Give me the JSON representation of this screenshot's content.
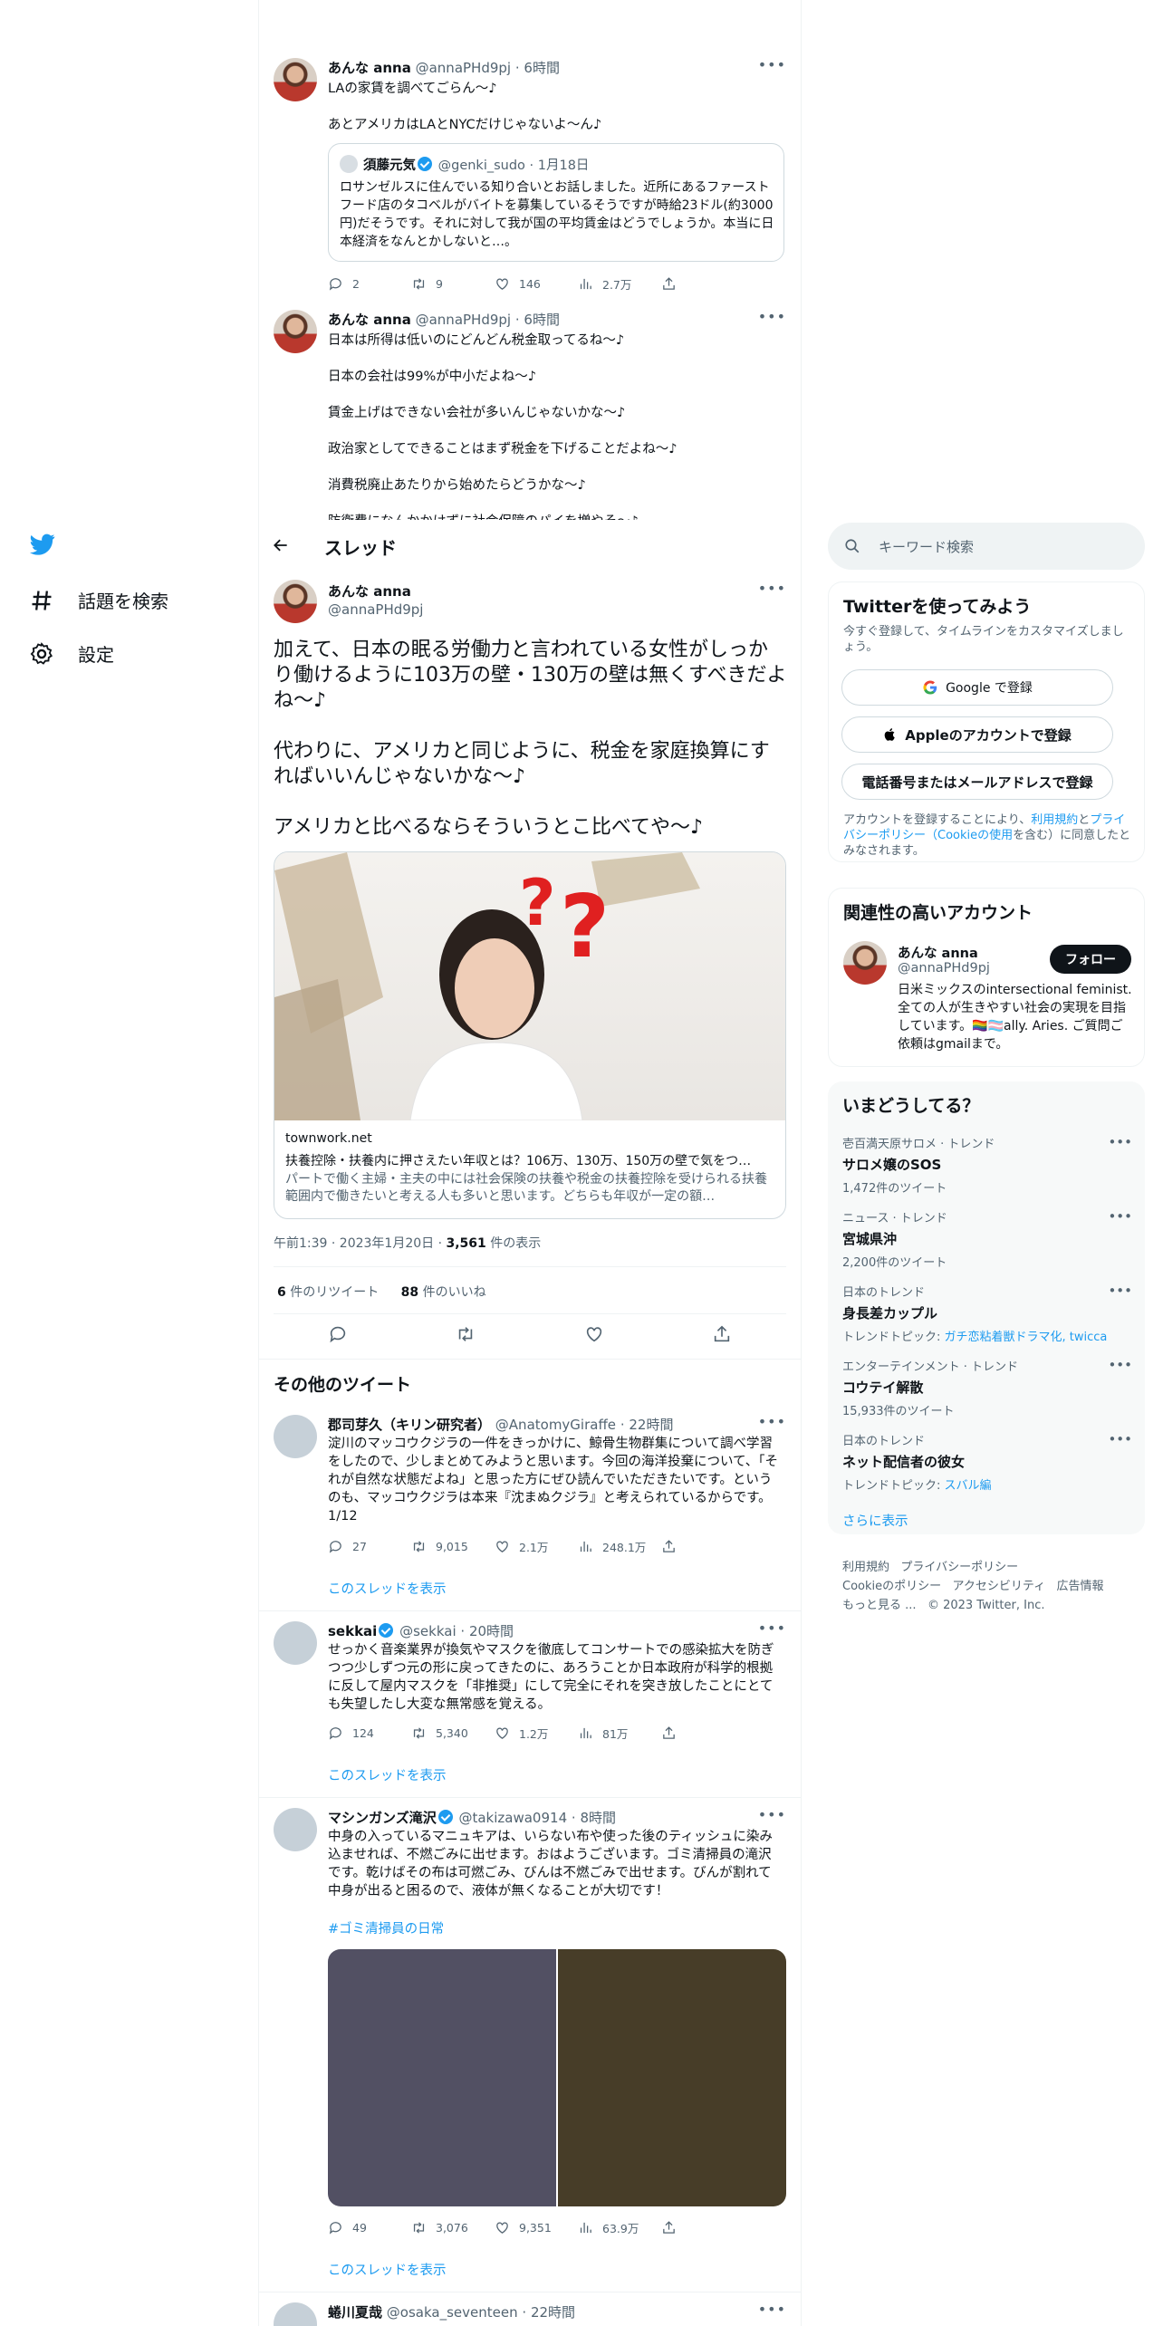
{
  "nav": {
    "explore": "話題を検索",
    "settings": "設定"
  },
  "thread_header": {
    "title": "スレッド"
  },
  "top_tweets": [
    {
      "name": "あんな anna",
      "handle": "@annaPHd9pj",
      "time": "6時間",
      "text": "LAの家賃を調べてごらん〜♪\n\nあとアメリカはLAとNYCだけじゃないよ〜ん♪",
      "quote": {
        "name": "須藤元気",
        "handle": "@genki_sudo",
        "time": "1月18日",
        "text": "ロサンゼルスに住んでいる知り合いとお話しました。近所にあるファーストフード店のタコベルがバイトを募集しているそうですが時給23ドル(約3000円)だそうです。それに対して我が国の平均賃金はどうでしょうか。本当に日本経済をなんとかしないと…。"
      },
      "stats": {
        "replies": "2",
        "retweets": "9",
        "likes": "146",
        "views": "2.7万"
      }
    },
    {
      "name": "あんな anna",
      "handle": "@annaPHd9pj",
      "time": "6時間",
      "text": "日本は所得は低いのにどんどん税金取ってるね〜♪\n\n日本の会社は99%が中小だよね〜♪\n\n賃金上げはできない会社が多いんじゃないかな〜♪\n\n政治家としてできることはまず税金を下げることだよね〜♪\n\n消費税廃止あたりから始めたらどうかな〜♪\n\n防衛費になんかかけずに社会保障のパイを増やそ〜♪"
    }
  ],
  "main_tweet": {
    "name": "あんな anna",
    "handle": "@annaPHd9pj",
    "text": "加えて、日本の眠る労働力と言われている女性がしっかり働けるように103万の壁・130万の壁は無くすべきだよね〜♪\n\n代わりに、アメリカと同じように、税金を家庭換算にすればいいんじゃないかな〜♪\n\nアメリカと比べるならそういうとこ比べてや〜♪",
    "card": {
      "domain": "townwork.net",
      "title": "扶養控除・扶養内に押さえたい年収とは？106万、130万、150万の壁で気をつ…",
      "desc": "パートで働く主婦・主夫の中には社会保険の扶養や税金の扶養控除を受けられる扶養範囲内で働きたいと考える人も多いと思います。どちらも年収が一定の額…"
    },
    "timestamp": "午前1:39 · 2023年1月20日 · ",
    "views_count": "3,561",
    "views_label": " 件の表示",
    "retweets_count": "6",
    "retweets_label": " 件のリツイート",
    "likes_count": "88",
    "likes_label": " 件のいいね"
  },
  "more_tweets_title": "その他のツイート",
  "more_tweets": [
    {
      "name": "郡司芽久（キリン研究者）",
      "handle": "@AnatomyGiraffe",
      "time": "22時間",
      "text": "淀川のマッコウクジラの一件をきっかけに、鯨骨生物群集について調べ学習をしたので、少しまとめてみようと思います。今回の海洋投棄について、「それが自然な状態だよね」と思った方にぜひ読んでいただきたいです。というのも、マッコウクジラは本来『沈まぬクジラ』と考えられているからです。1/12",
      "stats": {
        "replies": "27",
        "retweets": "9,015",
        "likes": "2.1万",
        "views": "248.1万"
      },
      "show_thread": "このスレッドを表示"
    },
    {
      "name": "sekkai",
      "handle": "@sekkai",
      "time": "20時間",
      "text": "せっかく音楽業界が換気やマスクを徹底してコンサートでの感染拡大を防ぎつつ少しずつ元の形に戻ってきたのに、あろうことか日本政府が科学的根拠に反して屋内マスクを「非推奨」にして完全にそれを突き放したことにとても失望したし大変な無常感を覚える。",
      "stats": {
        "replies": "124",
        "retweets": "5,340",
        "likes": "1.2万",
        "views": "81万"
      },
      "show_thread": "このスレッドを表示"
    },
    {
      "name": "マシンガンズ滝沢",
      "handle": "@takizawa0914",
      "time": "8時間",
      "text": "中身の入っているマニュキアは、いらない布や使った後のティッシュに染み込ませれば、不燃ごみに出せます。おはようございます。ゴミ清掃員の滝沢です。乾けばその布は可燃ごみ、びんは不燃ごみで出せます。びんが割れて中身が出ると困るので、液体が無くなることが大切です！",
      "hashtag": "#ゴミ清掃員の日常",
      "stats": {
        "replies": "49",
        "retweets": "3,076",
        "likes": "9,351",
        "views": "63.9万"
      },
      "show_thread": "このスレッドを表示",
      "image_colors": [
        "#525063",
        "#473d28"
      ]
    },
    {
      "name": "蜷川夏哉",
      "handle": "@osaka_seventeen",
      "time": "22時間"
    }
  ],
  "search": {
    "placeholder": "キーワード検索"
  },
  "signup": {
    "title": "Twitterを使ってみよう",
    "subtitle": "今すぐ登録して、タイムラインをカスタマイズしましょう。",
    "google": "Google で登録",
    "apple": "Appleのアカウントで登録",
    "phone": "電話番号またはメールアドレスで登録",
    "terms_prefix": "アカウントを登録することにより、",
    "terms_link": "利用規約",
    "terms_and": "と",
    "privacy_link": "プライバシーポリシー（Cookieの使用",
    "terms_suffix": "を含む）に同意したとみなされます。"
  },
  "related": {
    "title": "関連性の高いアカウント",
    "name": "あんな anna",
    "handle": "@annaPHd9pj",
    "follow": "フォロー",
    "bio": "日米ミックスのintersectional feminist. 全ての人が生きやすい社会の実現を目指しています。🏳️‍🌈🏳️‍⚧️ally. Aries. ご質問ご依頼はgmailまで。"
  },
  "trends": {
    "title": "いまどうしてる？",
    "items": [
      {
        "context": "壱百満天原サロメ · トレンド",
        "name": "サロメ嬢のSOS",
        "meta": "1,472件のツイート"
      },
      {
        "context": "ニュース · トレンド",
        "name": "宮城県沖",
        "meta": "2,200件のツイート"
      },
      {
        "context": "日本のトレンド",
        "name": "身長差カップル",
        "meta_prefix": "トレンドトピック: ",
        "meta_links": "ガチ恋粘着獣ドラマ化, twicca"
      },
      {
        "context": "エンターテインメント · トレンド",
        "name": "コウテイ解散",
        "meta": "15,933件のツイート"
      },
      {
        "context": "日本のトレンド",
        "name": "ネット配信者の彼女",
        "meta_prefix": "トレンドトピック: ",
        "meta_links": "スバル編"
      }
    ],
    "show_more": "さらに表示"
  },
  "footer": {
    "terms": "利用規約",
    "privacy": "プライバシーポリシー",
    "cookie": "Cookieのポリシー",
    "access": "アクセシビリティ",
    "ads": "広告情報",
    "more": "もっと見る ...",
    "copyright": "© 2023 Twitter, Inc."
  },
  "colors": {
    "accent": "#1d9bf0",
    "text": "#0f1419",
    "muted": "#536471",
    "border": "#eff3f4"
  }
}
